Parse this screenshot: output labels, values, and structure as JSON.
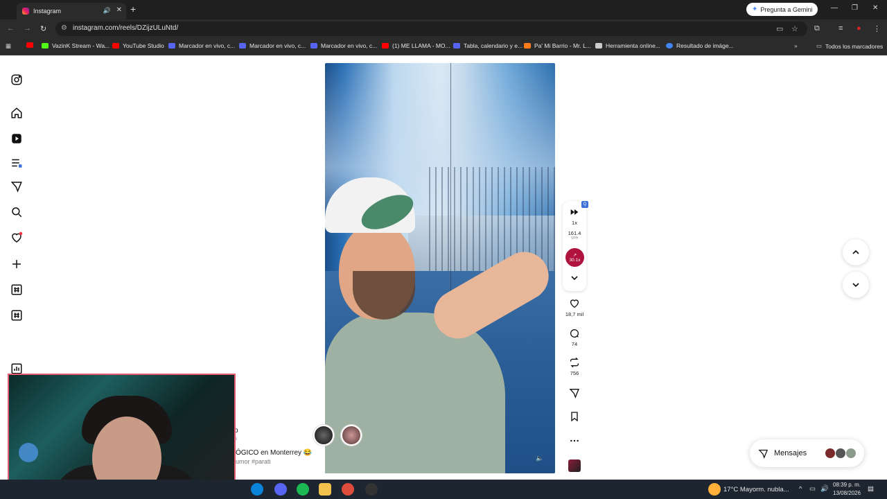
{
  "browser": {
    "tab_title": "Instagram",
    "new_tab": "+",
    "gemini_label": "Pregunta a Gemini",
    "url": "instagram.com/reels/DZijzULuNtd/",
    "bookmarks": [
      {
        "label": "",
        "color": "#ff0000"
      },
      {
        "label": "VazinK Stream - Wa...",
        "color": "#53fc18"
      },
      {
        "label": "YouTube Studio",
        "color": "#ff0000"
      },
      {
        "label": "Marcador en vivo, c...",
        "color": "#5865f2"
      },
      {
        "label": "Marcador en vivo, c...",
        "color": "#5865f2"
      },
      {
        "label": "Marcador en vivo, c...",
        "color": "#5865f2"
      },
      {
        "label": "(1) ME LLAMA - MO...",
        "color": "#ff0000"
      },
      {
        "label": "Tabla, calendario y e...",
        "color": "#5865f2"
      },
      {
        "label": "Pa' Mi Barrio - Mr. L...",
        "color": "#ff7a1a"
      },
      {
        "label": "Herramienta online...",
        "color": "#cccccc"
      },
      {
        "label": "Resultado de imáge...",
        "color": "#4285f4"
      }
    ],
    "all_bookmarks": "Todos los marcadores"
  },
  "sidebar": {
    "icons": [
      "instagram-logo-icon",
      "home-icon",
      "reels-icon",
      "feed-icon",
      "messages-icon",
      "search-icon",
      "notifications-icon",
      "create-icon",
      "hashtag-icon",
      "hashtag-icon",
      "dashboard-icon"
    ]
  },
  "reel": {
    "speed": "1x",
    "vph": "161.4",
    "vph_unit": "VPH",
    "trend": "30.1x",
    "likes": "18,7 mil",
    "comments": "74",
    "reposts": "756",
    "caption": "ÓGICO en Monterrey 😂",
    "caption_tags": "umor #parati",
    "caption_top": "o",
    "caption_mid": "s"
  },
  "messages": {
    "label": "Mensajes"
  },
  "taskbar": {
    "weather": "17°C  Mayorm. nubla...",
    "time": "08:39 p. m.",
    "date": "13/08/2026"
  }
}
